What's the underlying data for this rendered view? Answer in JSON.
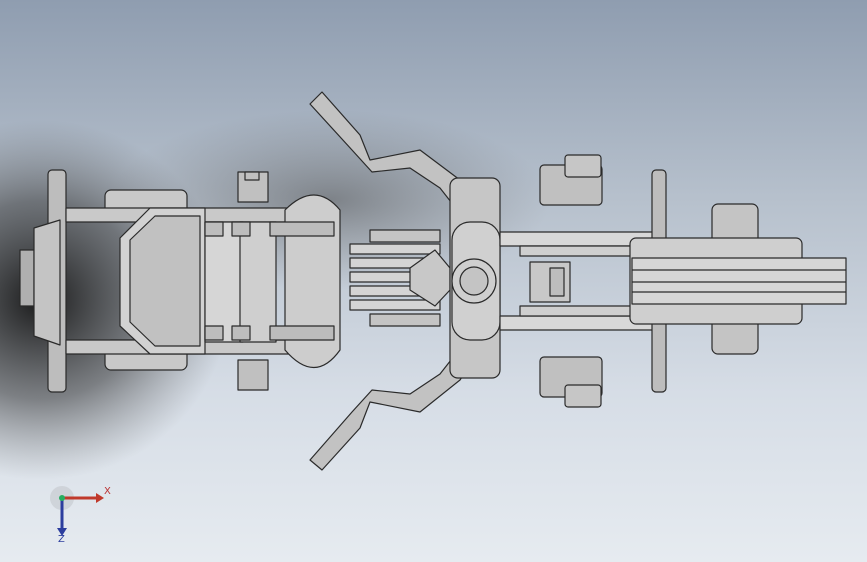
{
  "viewport": {
    "background_top": "#8f9db0",
    "background_bottom": "#e6ebf0",
    "part_fill": "#c9c9c9",
    "part_stroke": "#2a2a2a"
  },
  "triad": {
    "x_label": "X",
    "z_label": "Z",
    "x_color": "#c0392b",
    "y_color": "#27ae60",
    "z_color": "#2c3e9e"
  }
}
